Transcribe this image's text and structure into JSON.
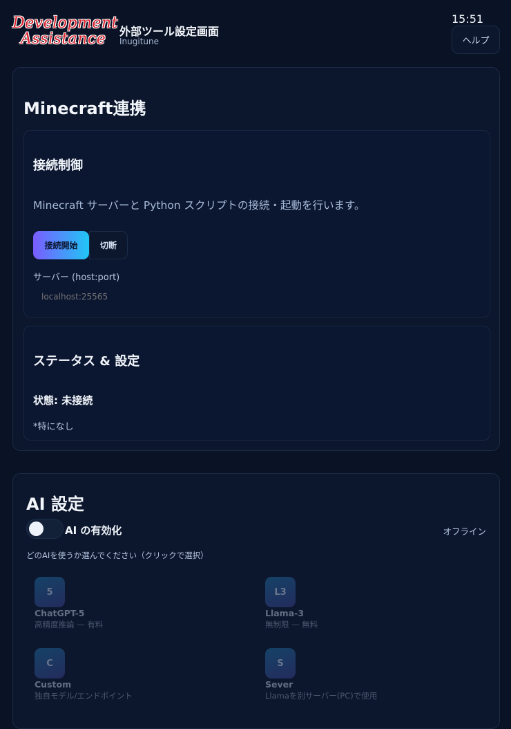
{
  "header": {
    "logo_line1": "Development",
    "logo_line2": "Assistance",
    "title": "外部ツール設定画面",
    "subtitle": "Inugitune",
    "clock": "15:51",
    "help_label": "ヘルプ"
  },
  "minecraft": {
    "section_title": "Minecraft連携",
    "connection": {
      "title": "接続制御",
      "description": "Minecraft サーバーと Python スクリプトの接続・起動を行います。",
      "connect_label": "接続開始",
      "disconnect_label": "切断",
      "server_label": "サーバー (host:port)",
      "server_placeholder": "localhost:25565"
    },
    "status": {
      "title": "ステータス & 設定",
      "state_label": "状態:",
      "state_value": "未接続",
      "note": "*特になし"
    }
  },
  "ai": {
    "section_title": "AI 設定",
    "toggle_label": "AI の有効化",
    "status_text": "オフライン",
    "hint": "どのAIを使うか選んでください（クリックで選択）",
    "options": [
      {
        "badge": "5",
        "name": "ChatGPT-5",
        "desc": "高精度推論 — 有料"
      },
      {
        "badge": "L3",
        "name": "Llama-3",
        "desc": "無制限 — 無料"
      },
      {
        "badge": "C",
        "name": "Custom",
        "desc": "独自モデル/エンドポイント"
      },
      {
        "badge": "S",
        "name": "Sever",
        "desc": "Llamaを別サーバー(PC)で使用"
      }
    ]
  },
  "colors": {
    "background": "#0a1326",
    "panel": "#0c172d",
    "accent_start": "#7a5cff",
    "accent_end": "#20c6f5",
    "logo_red": "#d9232e"
  }
}
